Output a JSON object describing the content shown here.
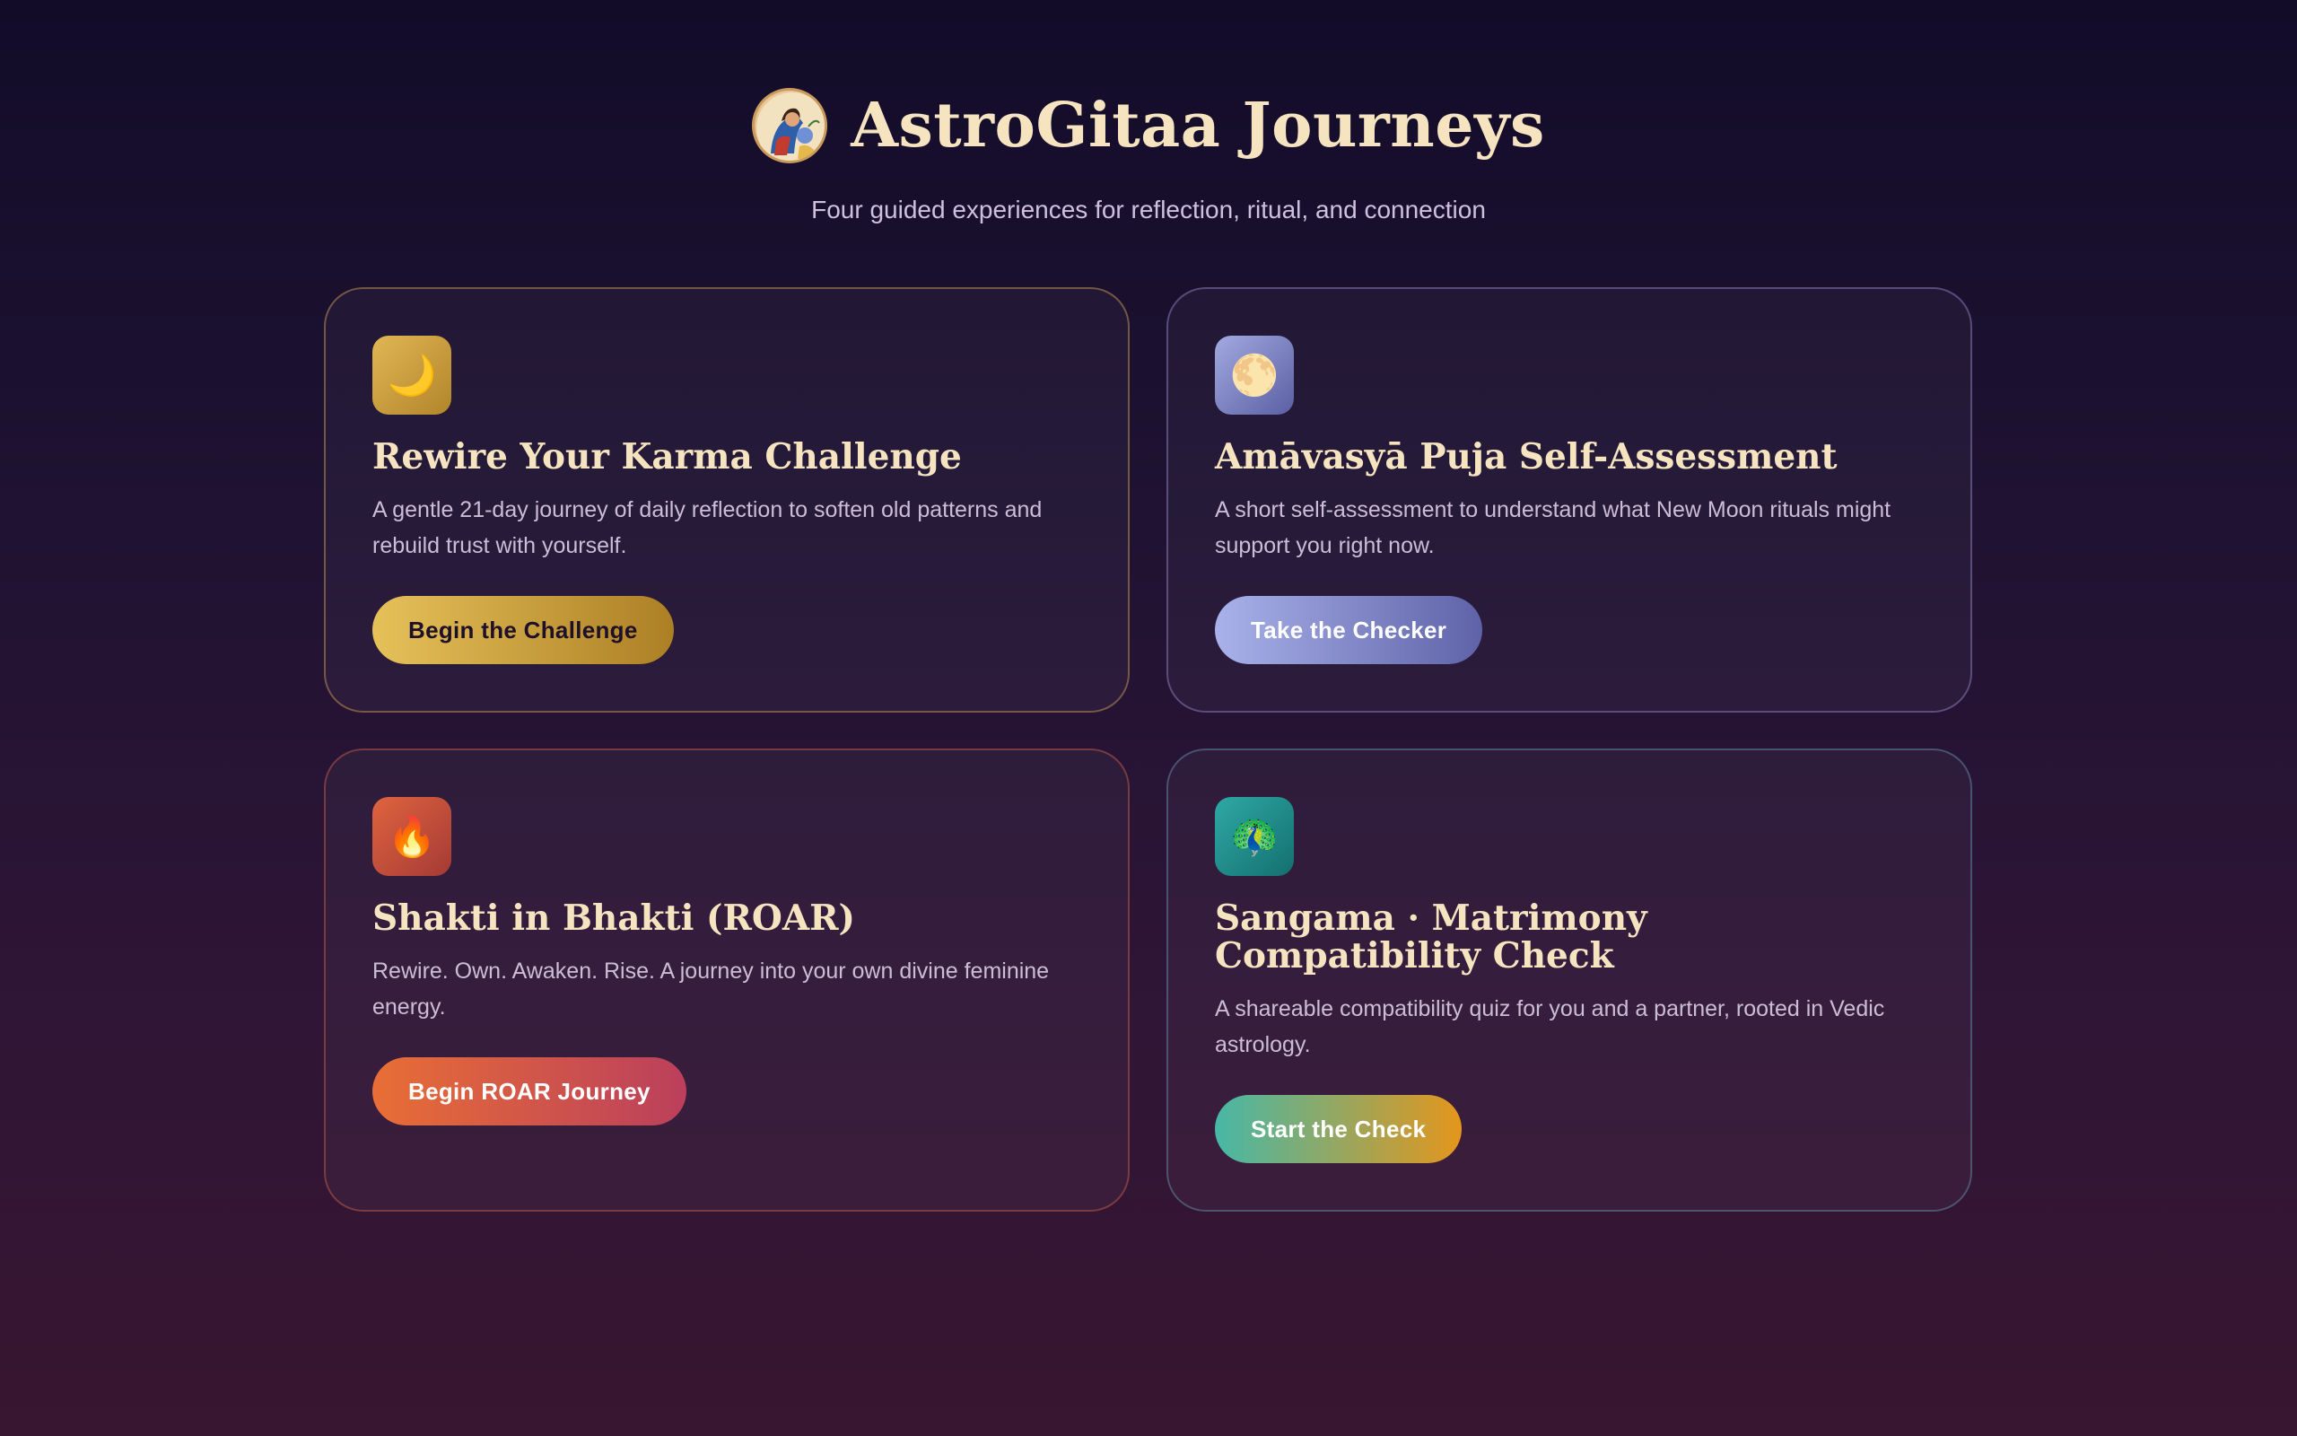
{
  "header": {
    "title": "AstroGitaa Journeys",
    "subtitle": "Four guided experiences for reflection, ritual, and connection",
    "logo_icon": "krishna-avatar-icon"
  },
  "cards": [
    {
      "icon": "crescent-moon-icon",
      "icon_glyph": "🌙",
      "title": "Rewire Your Karma Challenge",
      "description": "A gentle 21-day journey of daily reflection to soften old patterns and rebuild trust with yourself.",
      "button": "Begin the Challenge",
      "accent": "#d9ae48"
    },
    {
      "icon": "full-moon-icon",
      "icon_glyph": "🌕",
      "title": "Amāvasyā Puja Self-Assessment",
      "description": "A short self-assessment to understand what New Moon rituals might support you right now.",
      "button": "Take the Checker",
      "accent": "#8e94d4"
    },
    {
      "icon": "flame-icon",
      "icon_glyph": "🔥",
      "title": "Shakti in Bhakti (ROAR)",
      "description": "Rewire. Own. Awaken. Rise. A journey into your own divine feminine energy.",
      "button": "Begin ROAR Journey",
      "accent": "#d9553a"
    },
    {
      "icon": "peacock-icon",
      "icon_glyph": "🦚",
      "title": "Sangama · Matrimony Compatibility Check",
      "description": "A shareable compatibility quiz for you and a partner, rooted in Vedic astrology.",
      "button": "Start the Check",
      "accent": "#1f9592"
    }
  ]
}
